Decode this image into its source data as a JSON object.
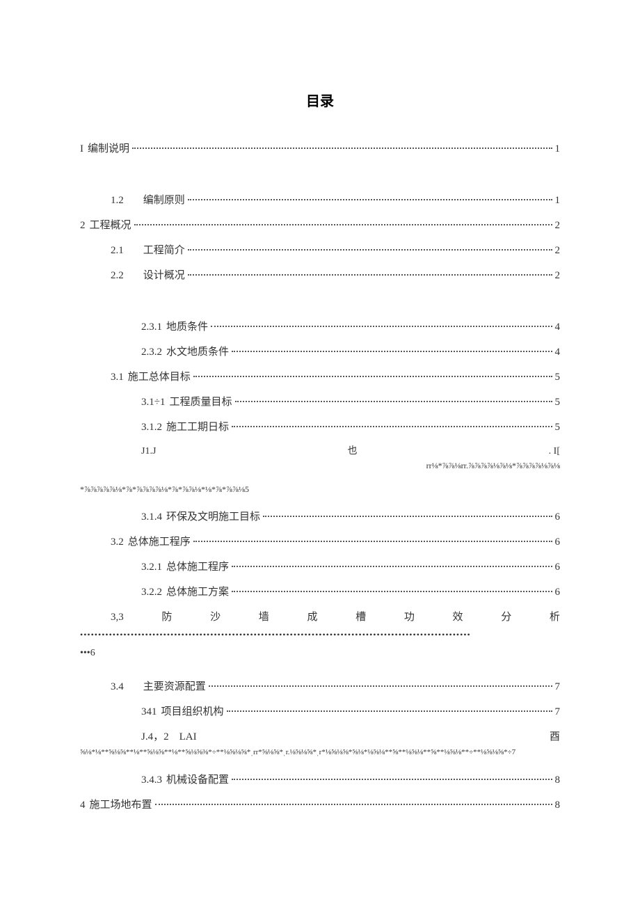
{
  "title": "目录",
  "items": [
    {
      "indent": 0,
      "num": "I",
      "text": "编制说明",
      "page": "1",
      "cls": "extra-gap"
    },
    {
      "indent": 1,
      "num": "1.2",
      "text": "编制原则",
      "page": "1",
      "numGap": true
    },
    {
      "indent": 0,
      "num": "2",
      "text": "工程概况",
      "page": "2"
    },
    {
      "indent": 1,
      "num": "2.1",
      "text": "工程简介",
      "page": "2",
      "numGap": true
    },
    {
      "indent": 1,
      "num": "2.2",
      "text": "设计概况",
      "page": "2",
      "numGap": true,
      "cls": "extra-gap"
    },
    {
      "indent": 2,
      "num": "2.3.1",
      "text": "地质条件",
      "page": "4"
    },
    {
      "indent": 2,
      "num": "2.3.2",
      "text": "水文地质条件",
      "page": "4"
    },
    {
      "indent": 1,
      "num": "3.1",
      "text": "施工总体目标",
      "page": "5"
    },
    {
      "indent": 2,
      "num": "3.1÷1",
      "text": "工程质量目标",
      "page": "5"
    },
    {
      "indent": 2,
      "num": "3.1.2",
      "text": "施工工期日标",
      "page": "5"
    }
  ],
  "garbled1": {
    "left": "J1.J",
    "mid": "也",
    "right": ". I[",
    "line2": "rr⅛*⅞⅞⅛rr.⅞⅞⅞⅞⅛⅞⅛*⅞⅞⅞⅞⅛⅞⅛",
    "line3": "*⅞⅞⅞⅞⅞⅛*⅞*⅞⅞⅞⅞⅛*⅞*⅞⅞⅛*⅛*⅞*⅞⅞⅛5"
  },
  "items2": [
    {
      "indent": 2,
      "num": "3.1.4",
      "text": "环保及文明施工目标",
      "page": "6"
    },
    {
      "indent": 1,
      "num": "3.2",
      "text": "总体施工程序",
      "page": "6"
    },
    {
      "indent": 2,
      "num": "3.2.1",
      "text": "总体施工程序",
      "page": "6"
    },
    {
      "indent": 2,
      "num": "3.2.2",
      "text": "总体施工方案",
      "page": "6"
    }
  ],
  "spaced": {
    "num": "3,3",
    "chars": [
      "防",
      "沙",
      "墙",
      "成",
      "槽",
      "功",
      "效",
      "分",
      "析"
    ],
    "dots": "••••••••••••••••••••••••••••••••••••••••••••••••••••••••••••••••••••••••••••••••••••••••••••••••••••••••••••",
    "tail": "•••6"
  },
  "items3": [
    {
      "indent": 1,
      "num": "3.4",
      "text": "主要资源配置",
      "page": "7",
      "numGap": true
    },
    {
      "indent": 2,
      "num": "341",
      "text": "项目组织机构",
      "page": "7"
    }
  ],
  "garbled2": {
    "left": "J.4，2 LAI",
    "right": "酉",
    "body": "⅝⅛*⅛**⅝⅛⅝**⅛**⅝⅛⅝**⅛**⅝⅛⅝⅜*÷**⅛⅝⅛⅝*ˌrr*⅝⅛⅝*ˌr.⅛⅝⅛⅝*ˌr*⅛⅝⅛⅝*⅝⅛*⅛⅝⅛**⅝**⅛⅝⅛**⅝**⅛⅝⅛**÷**⅛⅝⅛⅝*÷7"
  },
  "items4": [
    {
      "indent": 2,
      "num": "3.4.3",
      "text": "机械设备配置",
      "page": "8"
    },
    {
      "indent": 0,
      "num": "4",
      "text": "施工场地布置",
      "page": "8"
    }
  ]
}
